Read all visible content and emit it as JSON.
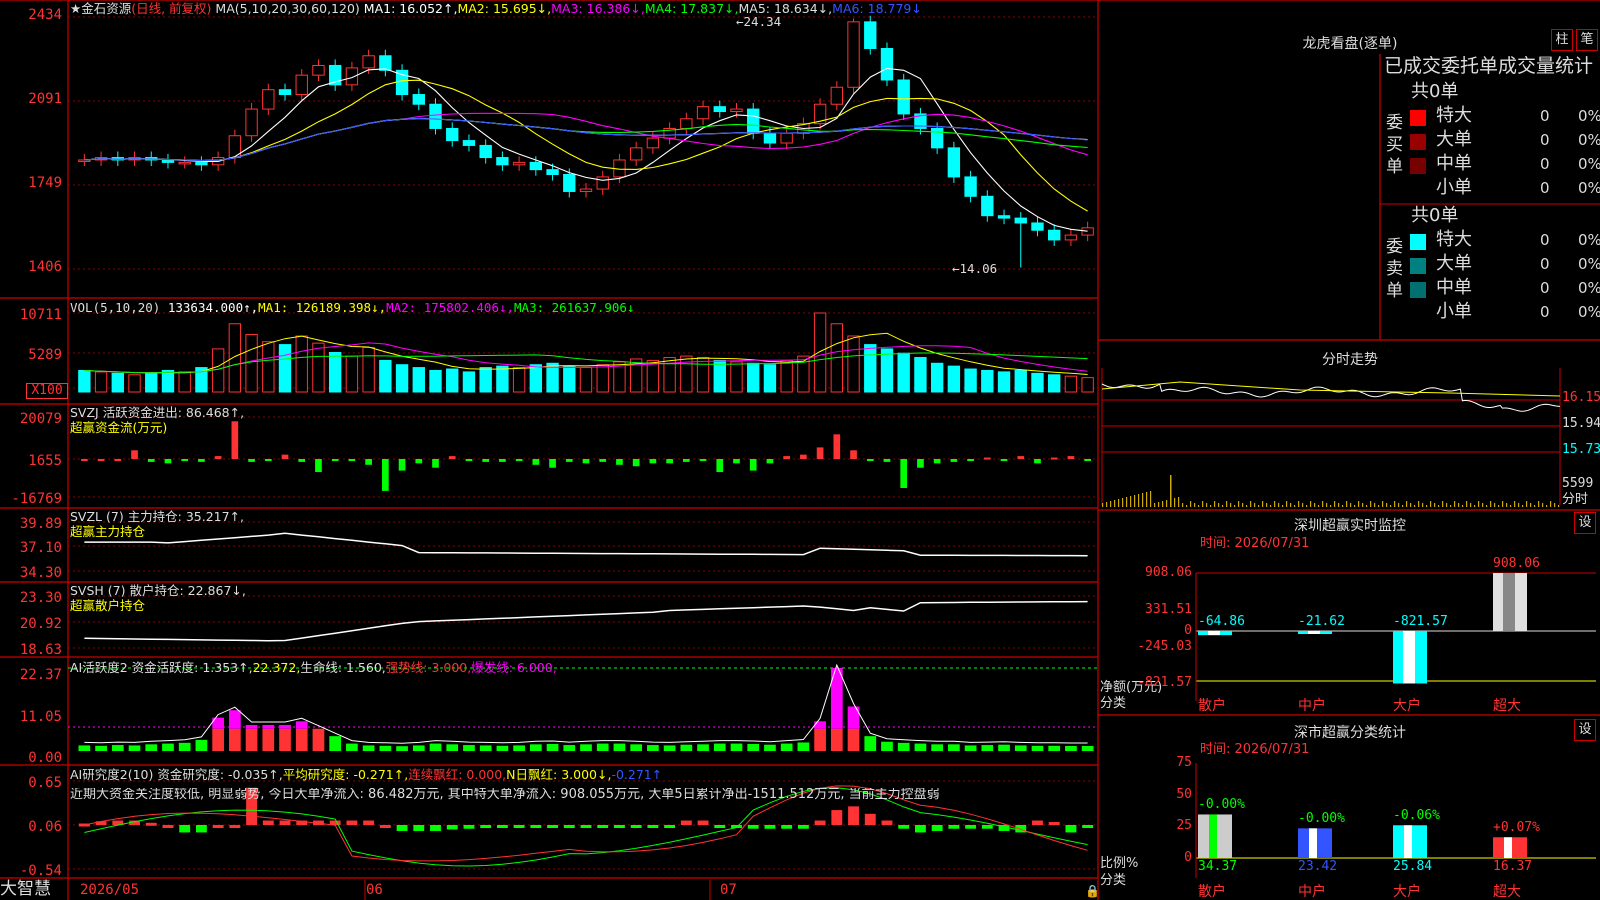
{
  "colors": {
    "up": "#ff3333",
    "down": "#00ffff",
    "bg": "#000000",
    "grid": "#8b0000",
    "frame": "#cc0000",
    "ma1": "#ffffff",
    "ma2": "#ffff00",
    "ma3": "#ff00ff",
    "ma4": "#00ff00",
    "ma5": "#ffffff",
    "ma6": "#3355ff",
    "green_bar": "#00ff00",
    "magenta": "#ff00ff",
    "dark_red": "#990000",
    "teal": "#008080"
  },
  "kline": {
    "title": "★金石资源",
    "mode": "(日线, 前复权)",
    "ma_label": "MA(5,10,20,30,60,120)",
    "ma1": "MA1: 16.052↑,",
    "ma2": "MA2: 15.695↓,",
    "ma3": "MA3: 16.386↓,",
    "ma4": "MA4: 17.837↓,",
    "ma5": "MA5: 18.634↓,",
    "ma6": "MA6: 18.779↓",
    "high_mark": "←24.34",
    "low_mark": "←14.06",
    "y_ticks": [
      "2434",
      "2091",
      "1749",
      "1406"
    ]
  },
  "vol": {
    "label": "VOL(5,10,20)",
    "v": "133634.000↑,",
    "ma1": "MA1: 126189.398↓,",
    "ma2": "MA2: 175802.406↓,",
    "ma3": "MA3: 261637.906↓",
    "y_ticks": [
      "10711",
      "5289"
    ],
    "unit": "X100"
  },
  "svzj": {
    "label": "SVZJ  活跃资金进出: 86.468↑,",
    "sub": "超赢资金流(万元)",
    "y_ticks": [
      "20079",
      "1655",
      "-16769"
    ]
  },
  "svzl": {
    "label": "SVZL (7) 主力持仓: 35.217↑,",
    "sub": "超赢主力持仓",
    "y_ticks": [
      "39.89",
      "37.10",
      "34.30"
    ]
  },
  "svsh": {
    "label": "SVSH (7) 散户持仓: 22.867↓,",
    "sub": "超赢散户持仓",
    "y_ticks": [
      "23.30",
      "20.92",
      "18.63"
    ]
  },
  "ai1": {
    "label": "AI活跃度2 资金活跃度: 1.353↑,",
    "v2": "22.372,",
    "v3": "生命线: 1.560,",
    "v4": "强势线: 3.000,",
    "v5": "爆发线: 6.000,",
    "y_ticks": [
      "22.37",
      "11.05",
      "0.00"
    ]
  },
  "ai2": {
    "label": "AI研究度2(10) 资金研究度: -0.035↑,",
    "v2": "平均研究度: -0.271↑,",
    "v3": "连续飘红: 0.000,",
    "v4": "N日飘红: 3.000↓,",
    "v5": "-0.271↑",
    "note": "近期大资金关注度较低, 明显弱势, 今日大单净流入: 86.482万元, 其中特大单净流入: 908.055万元, 大单5日累计净出-1511.512万元, 当前主力控盘弱",
    "y_ticks": [
      "0.65",
      "0.06",
      "-0.54"
    ]
  },
  "xaxis": {
    "labels": [
      "2026/05",
      "06",
      "07"
    ]
  },
  "brand": "大智慧",
  "longhu": {
    "title": "龙虎看盘(逐单)",
    "btn1": "柱",
    "btn2": "笔",
    "subtitle": "已成交委托单成交量统计",
    "buy": {
      "vlabel": "委买单",
      "total": "共0单",
      "rows": [
        {
          "name": "特大",
          "v": "0",
          "p": "0%"
        },
        {
          "name": "大单",
          "v": "0",
          "p": "0%"
        },
        {
          "name": "中单",
          "v": "0",
          "p": "0%"
        },
        {
          "name": "小单",
          "v": "0",
          "p": "0%"
        }
      ]
    },
    "sell": {
      "vlabel": "委卖单",
      "total": "共0单",
      "rows": [
        {
          "name": "特大",
          "v": "0",
          "p": "0%"
        },
        {
          "name": "大单",
          "v": "0",
          "p": "0%"
        },
        {
          "name": "中单",
          "v": "0",
          "p": "0%"
        },
        {
          "name": "小单",
          "v": "0",
          "p": "0%"
        }
      ]
    }
  },
  "intraday": {
    "title": "分时走势",
    "y_ticks": [
      "16.15",
      "15.94",
      "15.73",
      "5599"
    ],
    "unit": "分时"
  },
  "monitor": {
    "title": "深圳超赢实时监控",
    "btn": "设",
    "time": "时间: 2026/07/31",
    "y_ticks": [
      "908.06",
      "331.51",
      "0",
      "-245.03",
      "-821.57"
    ],
    "left1": "净额(万元)",
    "left2": "分类",
    "cats": [
      "散户",
      "中户",
      "大户",
      "超大"
    ],
    "values": [
      "-64.86",
      "-21.62",
      "-821.57",
      "908.06"
    ],
    "chart_data": {
      "type": "bar",
      "categories": [
        "散户",
        "中户",
        "大户",
        "超大"
      ],
      "values": [
        -64.86,
        -21.62,
        -821.57,
        908.06
      ],
      "ylim": [
        -821.57,
        908.06
      ]
    }
  },
  "classify": {
    "title": "深市超赢分类统计",
    "btn": "设",
    "time": "时间: 2026/07/31",
    "y_ticks": [
      "75",
      "50",
      "25",
      "0"
    ],
    "left1": "比例%",
    "left2": "分类",
    "cats": [
      "散户",
      "中户",
      "大户",
      "超大"
    ],
    "pct": [
      "-0.00%",
      "-0.00%",
      "-0.06%",
      "+0.07%"
    ],
    "values": [
      "34.37",
      "23.42",
      "25.84",
      "16.37"
    ],
    "chart_data": {
      "type": "bar",
      "categories": [
        "散户",
        "中户",
        "大户",
        "超大"
      ],
      "values": [
        34.37,
        23.42,
        25.84,
        16.37
      ],
      "ylim": [
        0,
        75
      ]
    }
  }
}
